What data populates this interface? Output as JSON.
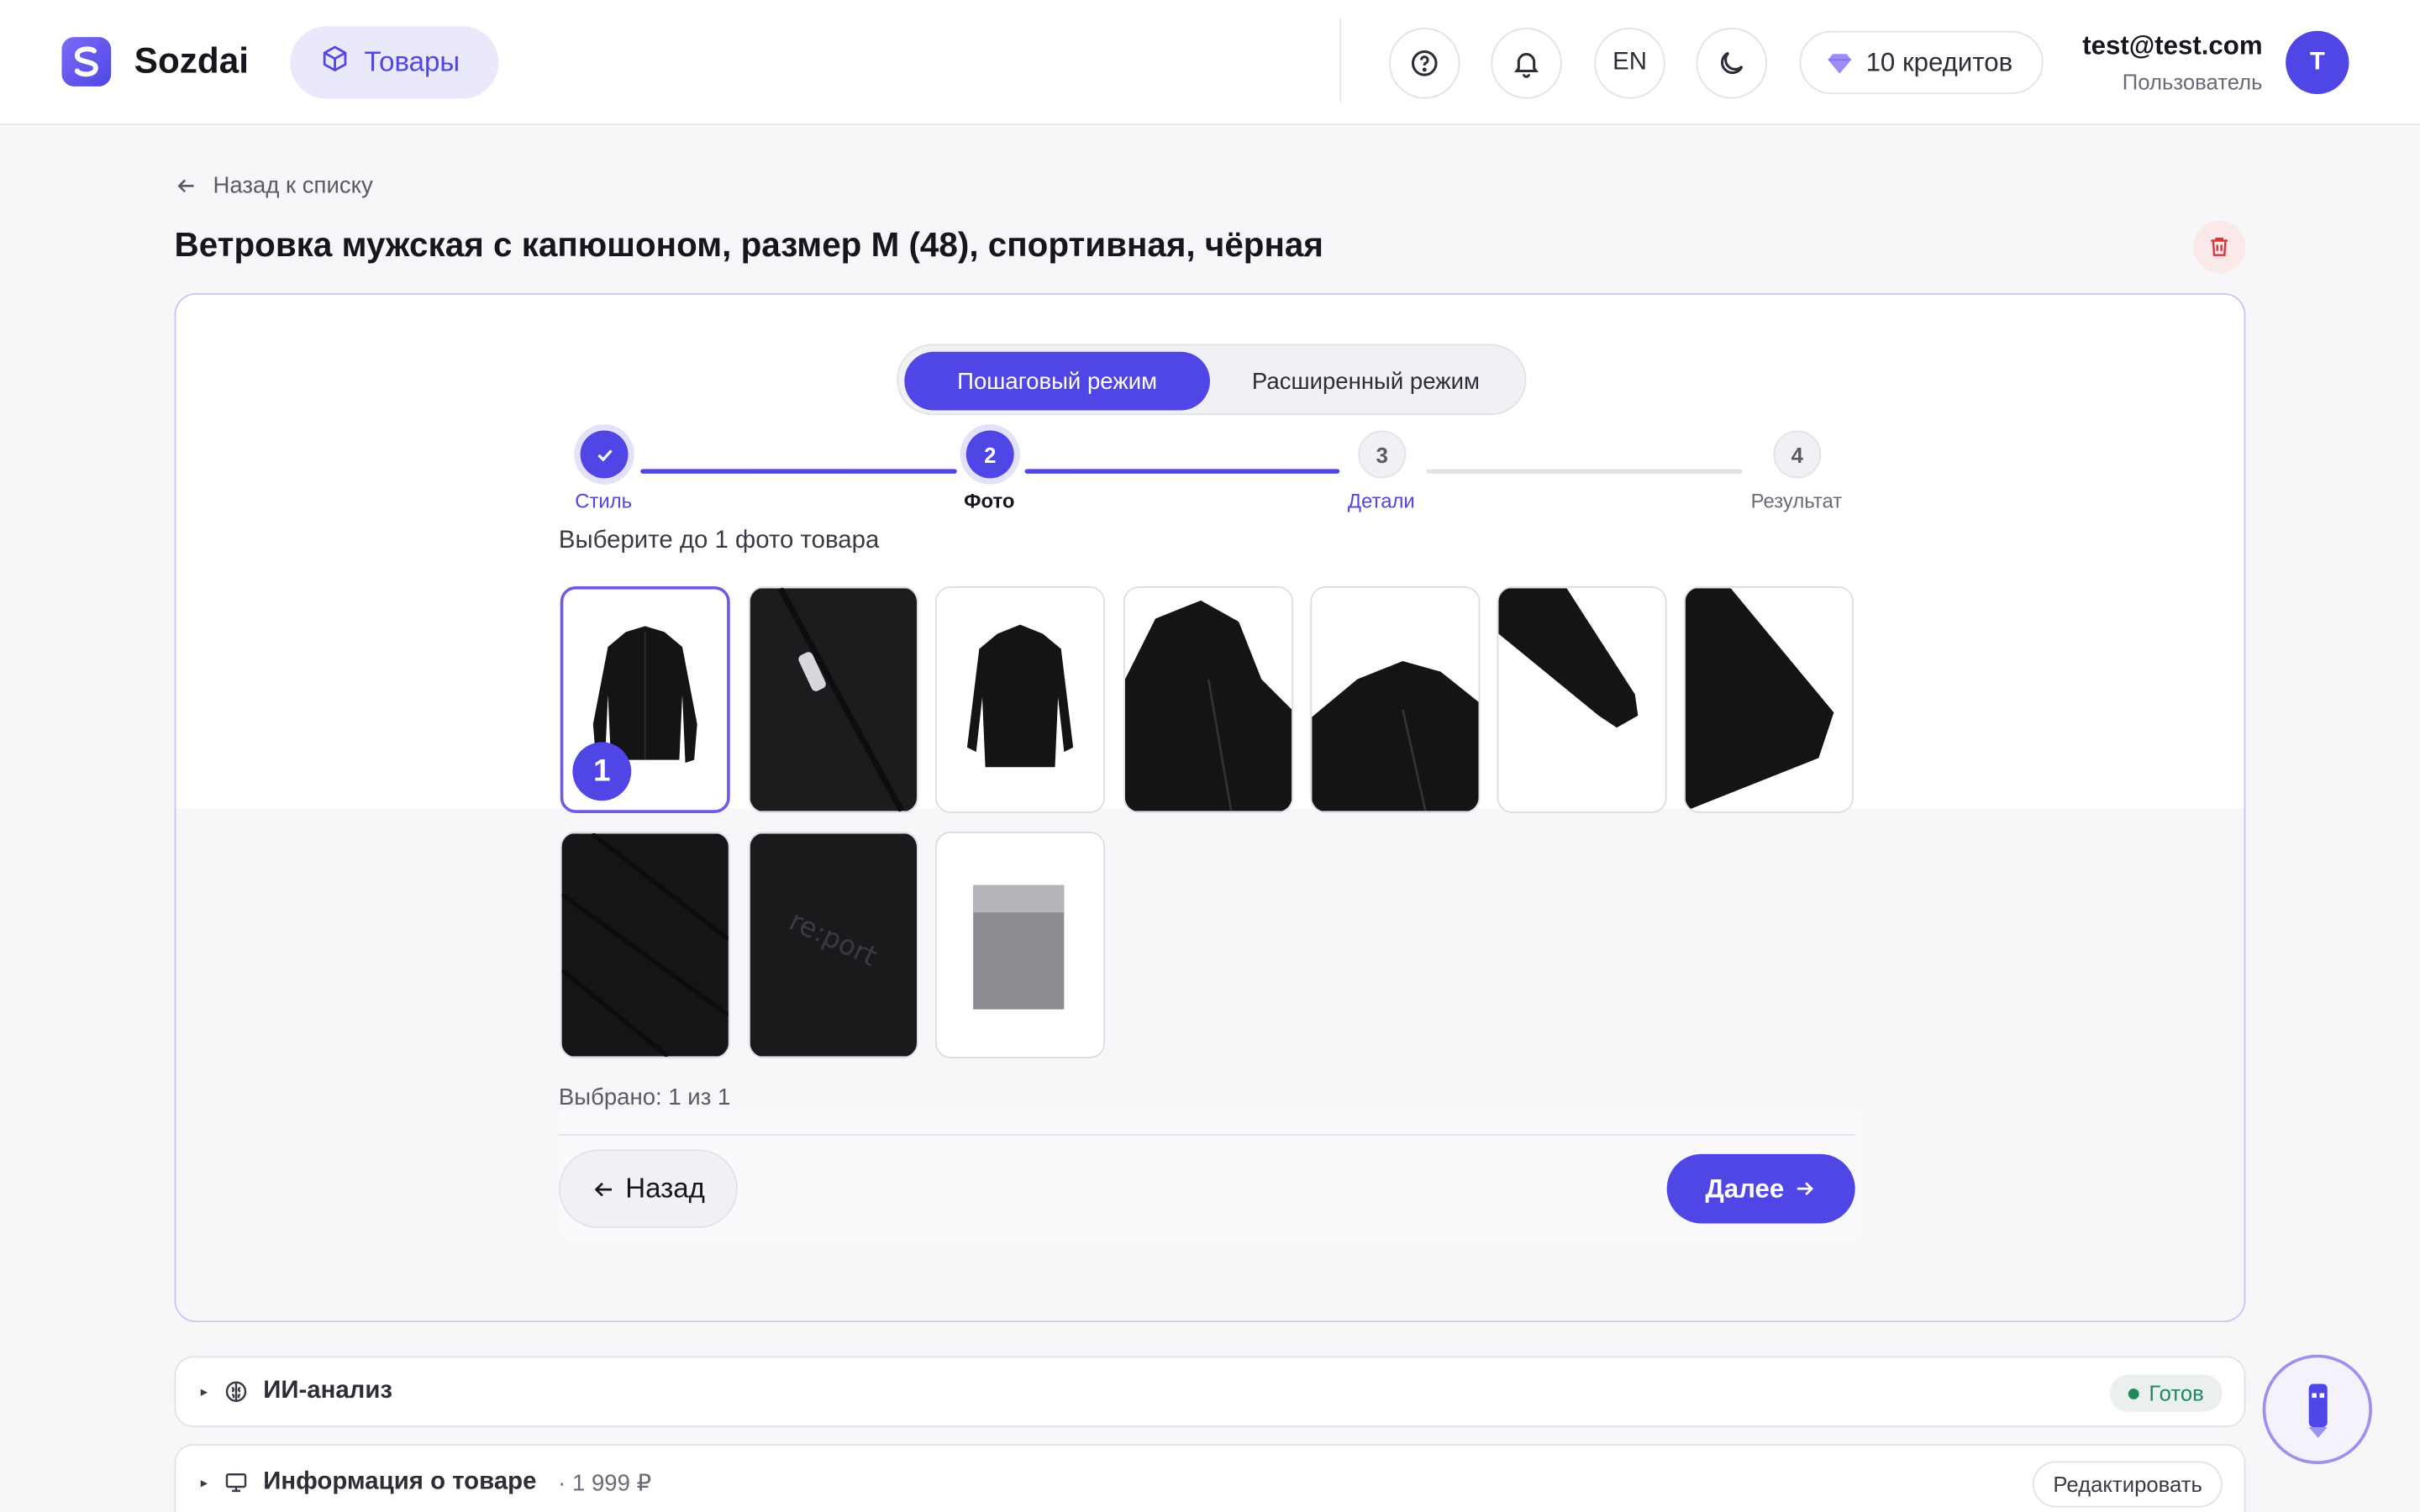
{
  "app": {
    "brand": "Sozdai",
    "nav_label": "Товары",
    "language": "EN",
    "credits": "10 кредитов",
    "user_email": "test@test.com",
    "user_role": "Пользователь",
    "avatar_letter": "T",
    "accent_color": "#4f46e5"
  },
  "product": {
    "back_label": "Назад к списку",
    "title": "Ветровка мужская с капюшоном, размер M (48), спортивная, чёрная"
  },
  "wizard": {
    "mode_step": "Пошаговый режим",
    "mode_advanced": "Расширенный режим",
    "steps": [
      {
        "label": "Стиль",
        "number": "1",
        "state": "done"
      },
      {
        "label": "Фото",
        "number": "2",
        "state": "active"
      },
      {
        "label": "Детали",
        "number": "3",
        "state": "idle"
      },
      {
        "label": "Результат",
        "number": "4",
        "state": "idle"
      }
    ],
    "instruction": "Выберите до 1 фото товара",
    "selected_badge": "1",
    "selected_count": "Выбрано: 1 из 1",
    "back_button": "Назад",
    "next_button": "Далее"
  },
  "sections": {
    "ai_title": "ИИ-анализ",
    "ai_status": "Готов",
    "info_title": "Информация о товаре",
    "info_price": "· 1 999 ₽",
    "info_edit": "Редактировать"
  },
  "photos": [
    {
      "id": "front",
      "selected": true
    },
    {
      "id": "zipper"
    },
    {
      "id": "back"
    },
    {
      "id": "hood"
    },
    {
      "id": "collar"
    },
    {
      "id": "cuff"
    },
    {
      "id": "side"
    },
    {
      "id": "fabric"
    },
    {
      "id": "logo"
    },
    {
      "id": "packaged"
    }
  ]
}
